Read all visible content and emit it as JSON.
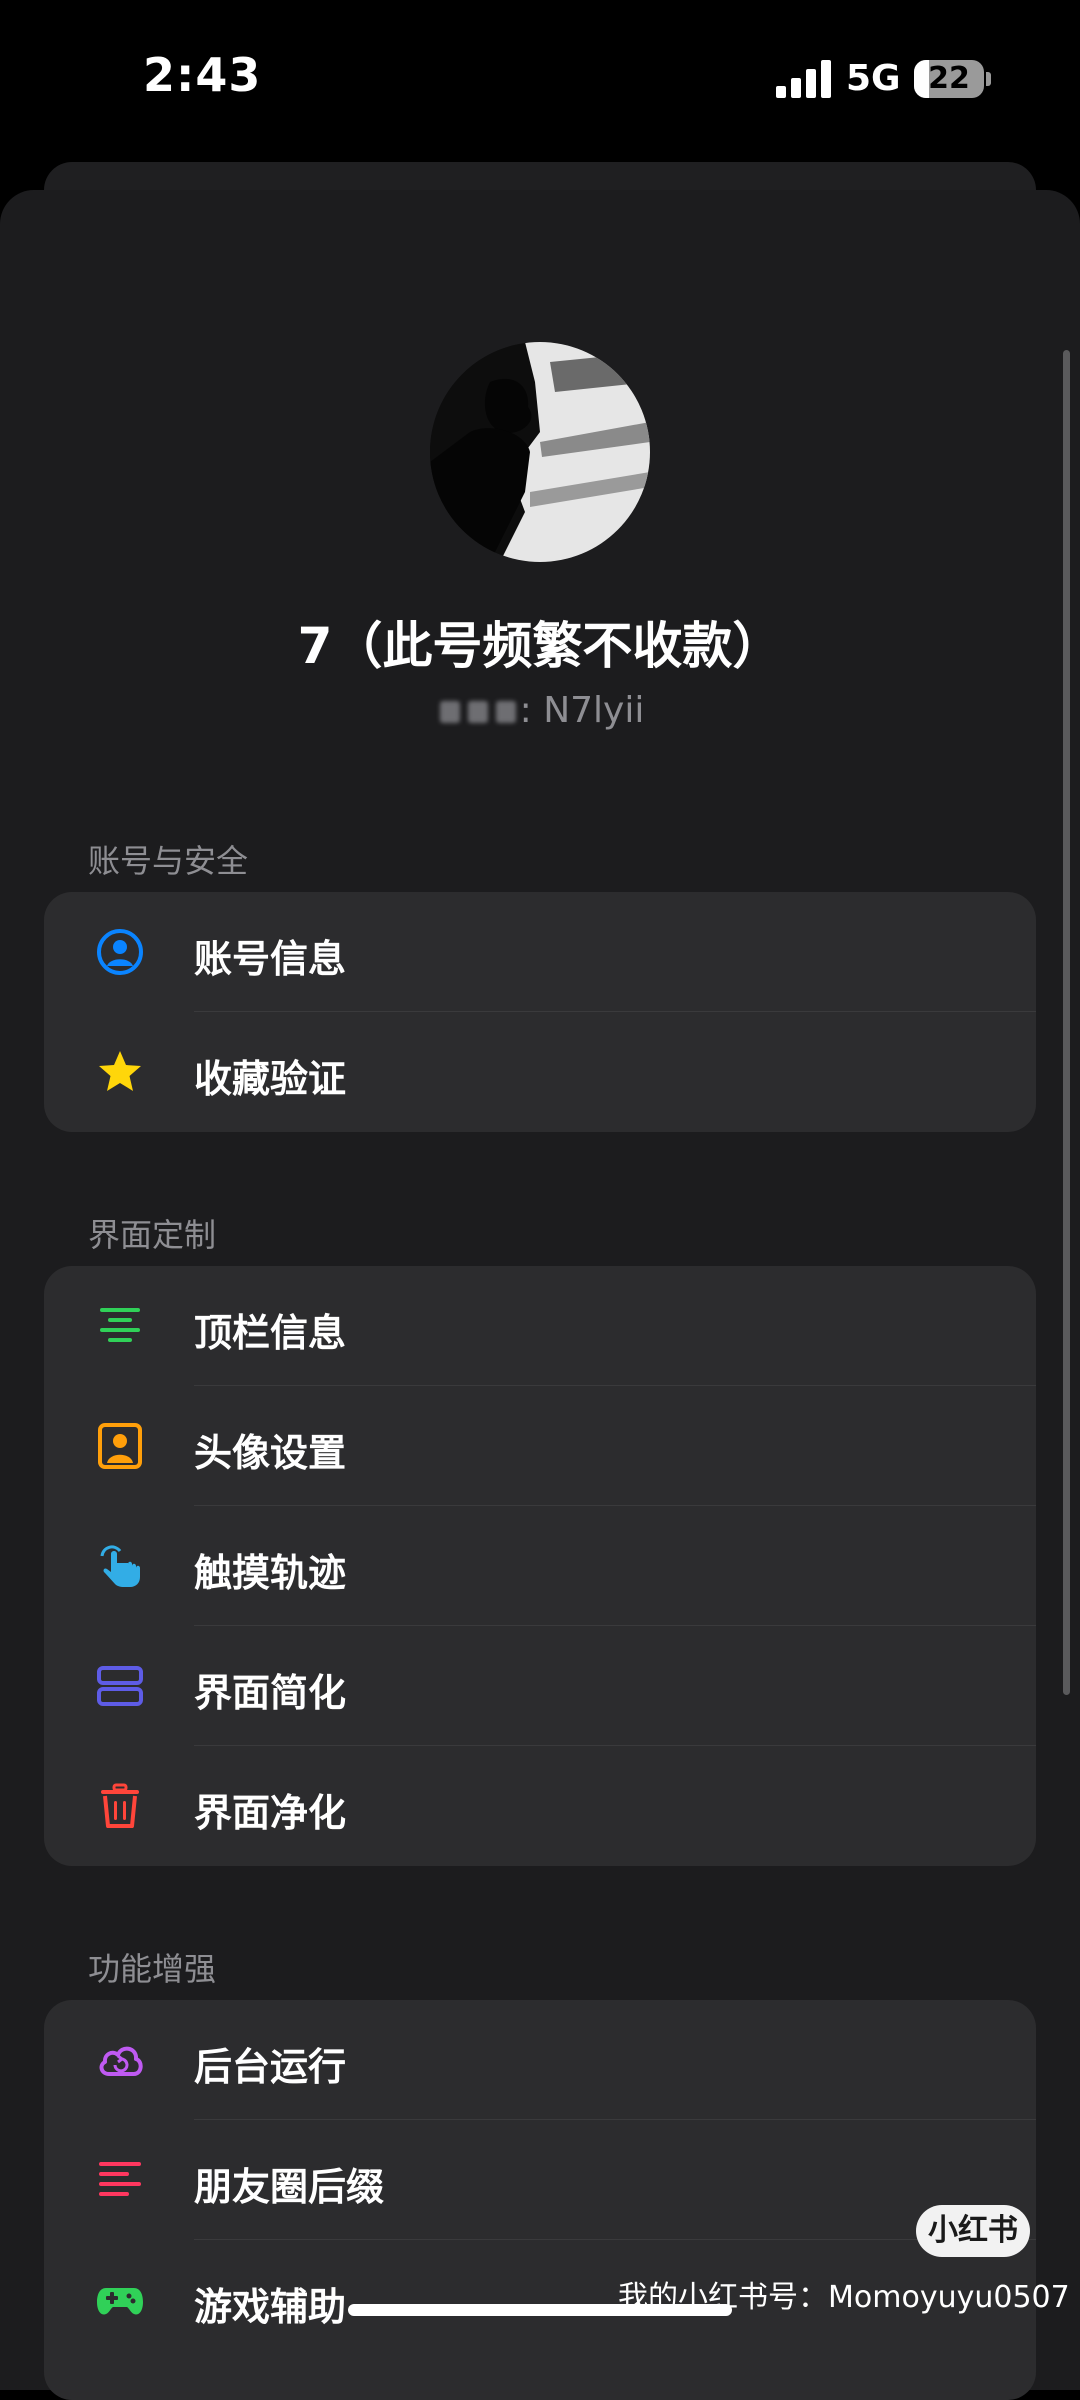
{
  "status_bar": {
    "time": "2:43",
    "network": "5G",
    "battery": "22",
    "battery_level": 0.22
  },
  "profile": {
    "name": "7（此号频繁不收款）",
    "id_label": ": N7lyii"
  },
  "sections": [
    {
      "title": "账号与安全",
      "items": [
        {
          "label": "账号信息",
          "icon": "user-circle-icon",
          "color": "#0a84ff"
        },
        {
          "label": "收藏验证",
          "icon": "star-icon",
          "color": "#ffd60a"
        }
      ]
    },
    {
      "title": "界面定制",
      "items": [
        {
          "label": "顶栏信息",
          "icon": "align-center-lines-icon",
          "color": "#30d158"
        },
        {
          "label": "头像设置",
          "icon": "portrait-icon",
          "color": "#ff9f0a"
        },
        {
          "label": "触摸轨迹",
          "icon": "hand-tap-icon",
          "color": "#32ade6"
        },
        {
          "label": "界面简化",
          "icon": "stacked-panels-icon",
          "color": "#5e5ce6"
        },
        {
          "label": "界面净化",
          "icon": "trash-icon",
          "color": "#ff453a"
        }
      ]
    },
    {
      "title": "功能增强",
      "items": [
        {
          "label": "后台运行",
          "icon": "cloud-sync-icon",
          "color": "#bf5af2"
        },
        {
          "label": "朋友圈后缀",
          "icon": "align-left-lines-icon",
          "color": "#ff375f"
        },
        {
          "label": "游戏辅助",
          "icon": "gamepad-icon",
          "color": "#30d158"
        }
      ]
    }
  ],
  "watermark": {
    "badge": "小红书",
    "caption": "我的小红书号：Momoyuyu0507"
  }
}
